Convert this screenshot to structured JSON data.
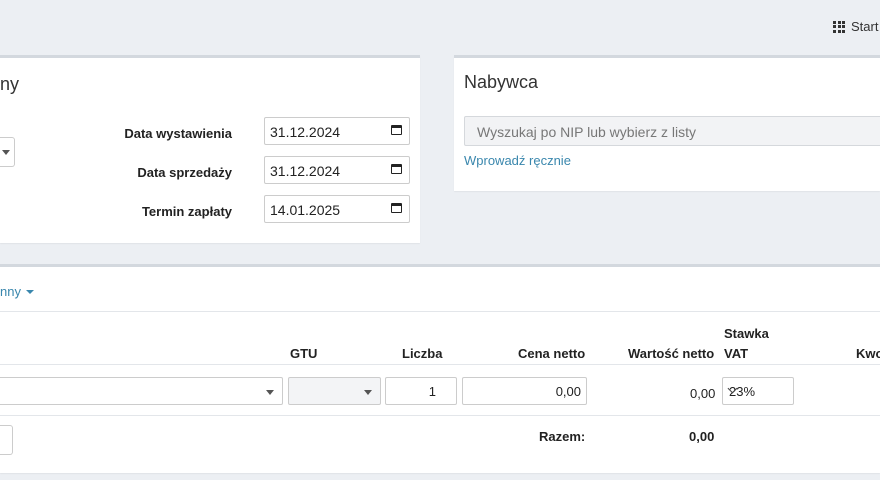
{
  "topbar": {
    "start_label": "Start"
  },
  "seller_card": {
    "title_fragment": "ny"
  },
  "dates": {
    "issue_label": "Data wystawienia",
    "issue_value": "31.12.2024",
    "sale_label": "Data sprzedaży",
    "sale_value": "31.12.2024",
    "due_label": "Termin zapłaty",
    "due_value": "14.01.2025"
  },
  "buyer": {
    "title": "Nabywca",
    "search_placeholder": "Wyszukaj po NIP lub wybierz z listy",
    "manual_link": "Wprowadź ręcznie"
  },
  "items": {
    "toggle_fragment": "nny",
    "headers": {
      "gtu": "GTU",
      "qty": "Liczba",
      "net_price": "Cena netto",
      "net_value": "Wartość netto",
      "vat_line1": "Stawka",
      "vat_line2": "VAT",
      "amount_fragment": "Kwo"
    },
    "row": {
      "qty": "1",
      "net_price": "0,00",
      "net_value": "0,00",
      "vat": "23%"
    },
    "total_label": "Razem:",
    "total_net": "0,00"
  },
  "colors": {
    "accent_link": "#3a87ad",
    "background": "#eceff3"
  },
  "icons": [
    "grid-icon",
    "calendar-icon",
    "caret-down-icon",
    "chevron-down-icon"
  ]
}
